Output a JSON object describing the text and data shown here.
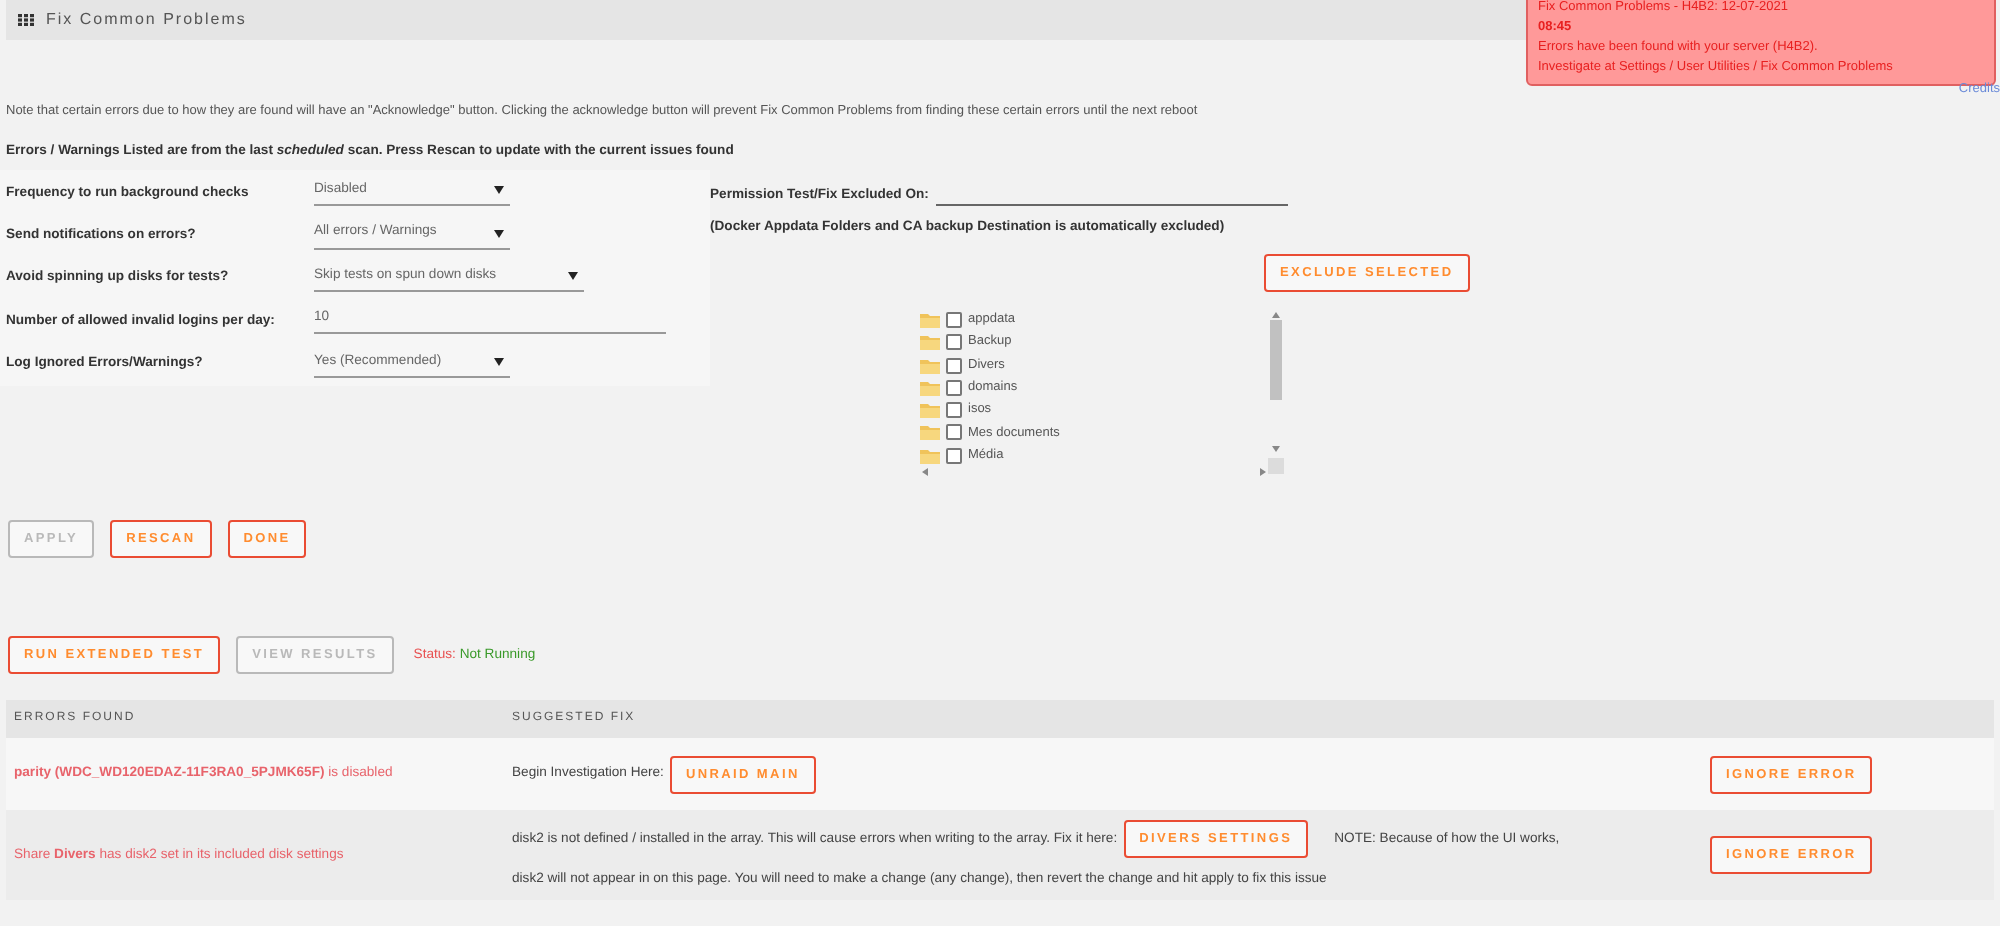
{
  "header": {
    "title": "Fix Common Problems"
  },
  "notification": {
    "title": "Fix Common Problems - H4B2: 12-07-2021",
    "time": "08:45",
    "message": "Errors have been found with your server (H4B2).",
    "path": "Investigate at Settings / User Utilities / Fix Common Problems"
  },
  "credits_link": "Credits",
  "note": "Note that certain errors due to how they are found will have an \"Acknowledge\" button. Clicking the acknowledge button will prevent Fix Common Problems from finding these certain errors until the next reboot",
  "scan_info": "Errors / Warnings Listed are from the last *scheduled* scan. Press Rescan to update with the current issues found",
  "settings": [
    {
      "label": "Frequency to run background checks",
      "kind": "select",
      "value": "Disabled"
    },
    {
      "label": "Send notifications on errors?",
      "kind": "select",
      "value": "All errors / Warnings"
    },
    {
      "label": "Avoid spinning up disks for tests?",
      "kind": "select",
      "value": "Skip tests on spun down disks"
    },
    {
      "label": "Number of allowed invalid logins per day:",
      "kind": "input",
      "value": "10"
    },
    {
      "label": "Log Ignored Errors/Warnings?",
      "kind": "select",
      "value": "Yes (Recommended)"
    }
  ],
  "permission": {
    "label": "Permission Test/Fix Excluded On:",
    "note": "(Docker Appdata Folders and CA backup Destination is automatically excluded)",
    "button": "EXCLUDE SELECTED",
    "folders": [
      {
        "name": "appdata",
        "checked": false
      },
      {
        "name": "Backup",
        "checked": false
      },
      {
        "name": "Divers",
        "checked": false
      },
      {
        "name": "domains",
        "checked": false
      },
      {
        "name": "isos",
        "checked": false
      },
      {
        "name": "Mes documents",
        "checked": false
      },
      {
        "name": "Média",
        "checked": false
      }
    ]
  },
  "actions": [
    {
      "label": "APPLY",
      "disabled": true
    },
    {
      "label": "RESCAN",
      "disabled": false
    },
    {
      "label": "DONE",
      "disabled": false
    }
  ],
  "extended": {
    "buttons": [
      {
        "label": "RUN EXTENDED TEST",
        "disabled": false
      },
      {
        "label": "VIEW RESULTS",
        "disabled": true
      }
    ],
    "status_label": "Status:",
    "status_value": "Not Running"
  },
  "table": {
    "columns": [
      "ERRORS FOUND",
      "SUGGESTED FIX"
    ],
    "rows": [
      {
        "error": "**parity (WDC_WD120EDAZ-11F3RA0_5PJMK65F)** is disabled",
        "fix_before": "Begin Investigation Here:",
        "fix_button": "UNRAID MAIN",
        "ignore": "IGNORE ERROR"
      },
      {
        "error": "Share **Divers** has disk2 set in its included disk settings",
        "fix_before": "disk2 is not defined / installed in the array. This will cause errors when writing to the array. Fix it here:",
        "fix_button": "DIVERS SETTINGS",
        "fix_after": [
          "NOTE: Because of how the UI works,",
          "disk2 will not appear in on this page. You will need to make a change (any change), then revert the change and hit apply to fix this issue"
        ],
        "ignore": "IGNORE ERROR"
      }
    ]
  }
}
